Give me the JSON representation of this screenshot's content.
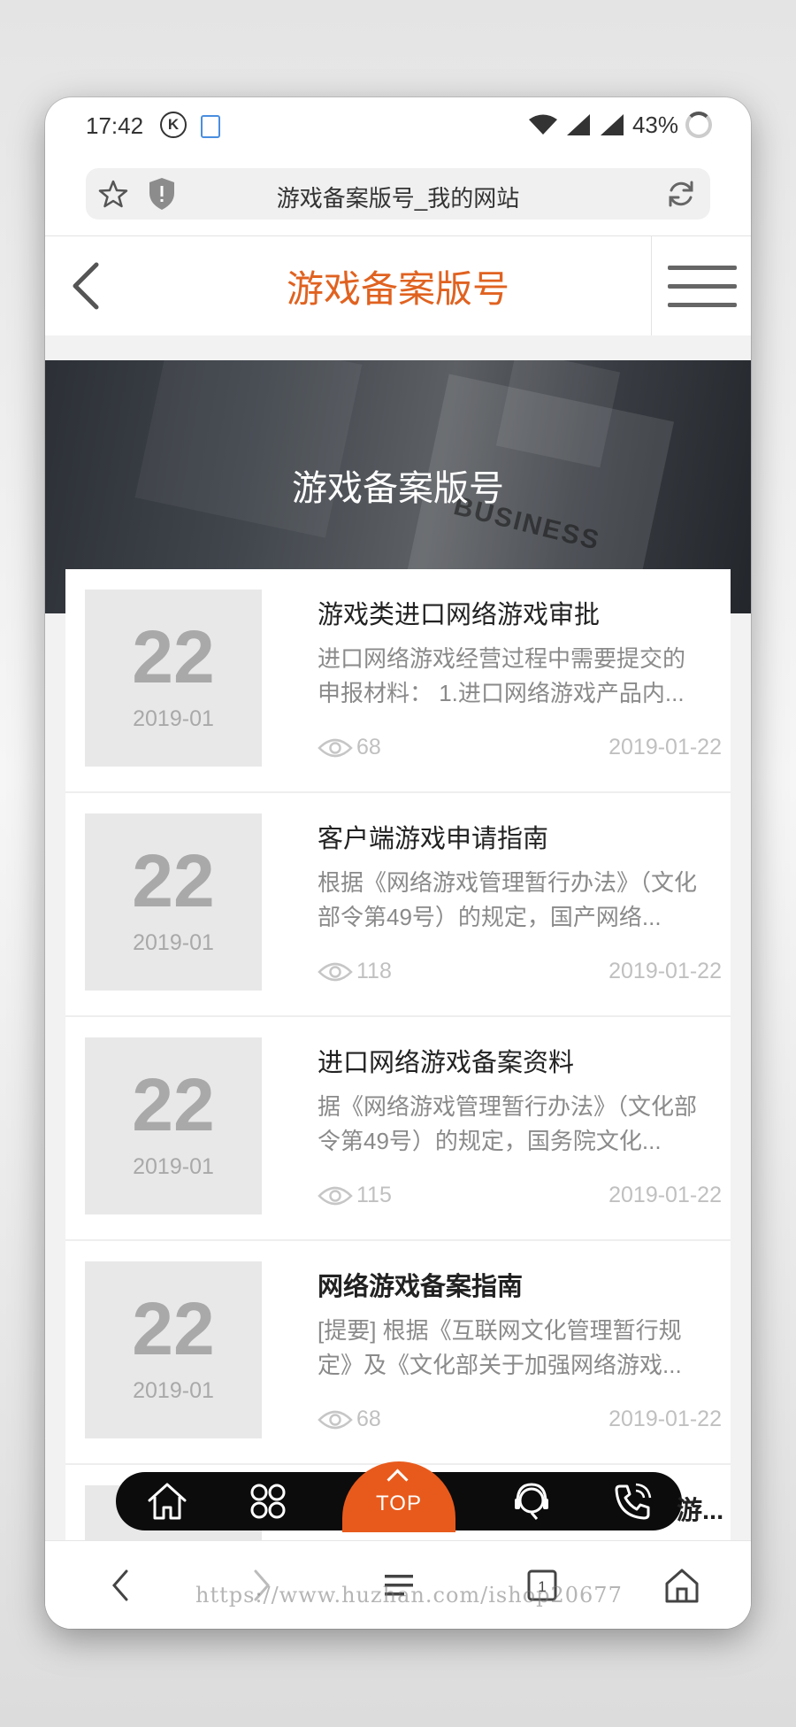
{
  "status_bar": {
    "time": "17:42",
    "k_badge": "K",
    "battery": "43%"
  },
  "url_bar": {
    "url_title": "游戏备案版号_我的网站"
  },
  "header": {
    "title": "游戏备案版号"
  },
  "banner": {
    "title": "游戏备案版号",
    "bg_text": "BUSINESS"
  },
  "articles": [
    {
      "day": "22",
      "year_month": "2019-01",
      "title": "游戏类进口网络游戏审批",
      "excerpt": "进口网络游戏经营过程中需要提交的申报材料： 1.进口网络游戏产品内...",
      "views": "68",
      "date": "2019-01-22"
    },
    {
      "day": "22",
      "year_month": "2019-01",
      "title": "客户端游戏申请指南",
      "excerpt": "根据《网络游戏管理暂行办法》（文化部令第49号）的规定，国产网络...",
      "views": "118",
      "date": "2019-01-22"
    },
    {
      "day": "22",
      "year_month": "2019-01",
      "title": "进口网络游戏备案资料",
      "excerpt": "据《网络游戏管理暂行办法》（文化部令第49号）的规定，国务院文化...",
      "views": "115",
      "date": "2019-01-22"
    },
    {
      "day": "22",
      "year_month": "2019-01",
      "title": "网络游戏备案指南",
      "excerpt": "[提要] 根据《互联网文化管理暂行规定》及《文化部关于加强网络游戏...",
      "views": "68",
      "date": "2019-01-22"
    }
  ],
  "partial_article": {
    "title_fragment": "游..."
  },
  "float_bar": {
    "top_label": "TOP"
  },
  "watermark": "https://www.huzhan.com/ishop20677",
  "colors": {
    "accent": "#e06220",
    "top_button": "#e85a1c",
    "float_bar": "#0c0c0c"
  }
}
